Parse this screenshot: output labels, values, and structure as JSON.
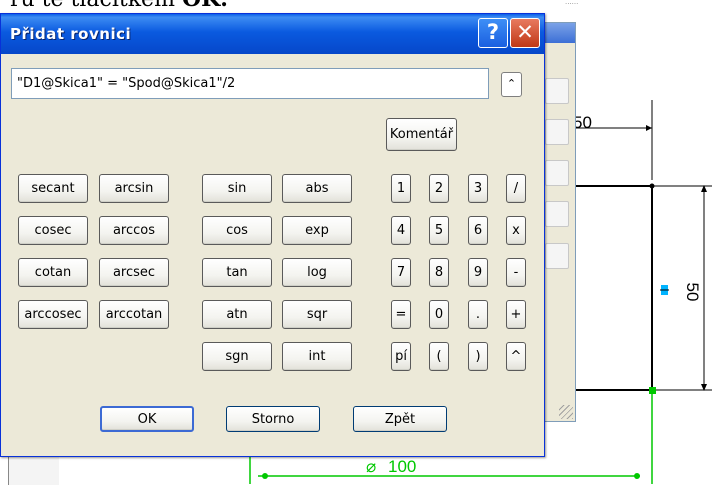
{
  "doc": {
    "text_pre": "ru te tlačítkem",
    "text_bold": "OK."
  },
  "cad": {
    "dim_top": "50",
    "dim_right": "50",
    "dim_bottom": "100"
  },
  "dialog": {
    "title": "Přidat rovnici",
    "help_symbol": "?",
    "close_symbol": "✕",
    "equation_value": "\"D1@Skica1\" = \"Spod@Skica1\"/2",
    "expand_symbol": "⌃",
    "comment_label": "Komentář",
    "func_col1": [
      "secant",
      "cosec",
      "cotan",
      "arccosec"
    ],
    "func_col2": [
      "arcsin",
      "arccos",
      "arcsec",
      "arccotan"
    ],
    "func_col3": [
      "sin",
      "cos",
      "tan",
      "atn",
      "sgn"
    ],
    "func_col4": [
      "abs",
      "exp",
      "log",
      "sqr",
      "int"
    ],
    "num_rows": [
      [
        "1",
        "2",
        "3",
        "/"
      ],
      [
        "4",
        "5",
        "6",
        "x"
      ],
      [
        "7",
        "8",
        "9",
        "-"
      ],
      [
        "=",
        "0",
        ".",
        "+"
      ],
      [
        "pí",
        "(",
        ")",
        "^"
      ]
    ],
    "ok_label": "OK",
    "cancel_label": "Storno",
    "back_label": "Zpět"
  },
  "colors": {
    "title_blue": "#0a5ae0",
    "cad_green": "#00c800",
    "selection_cyan": "#00b4ff"
  }
}
